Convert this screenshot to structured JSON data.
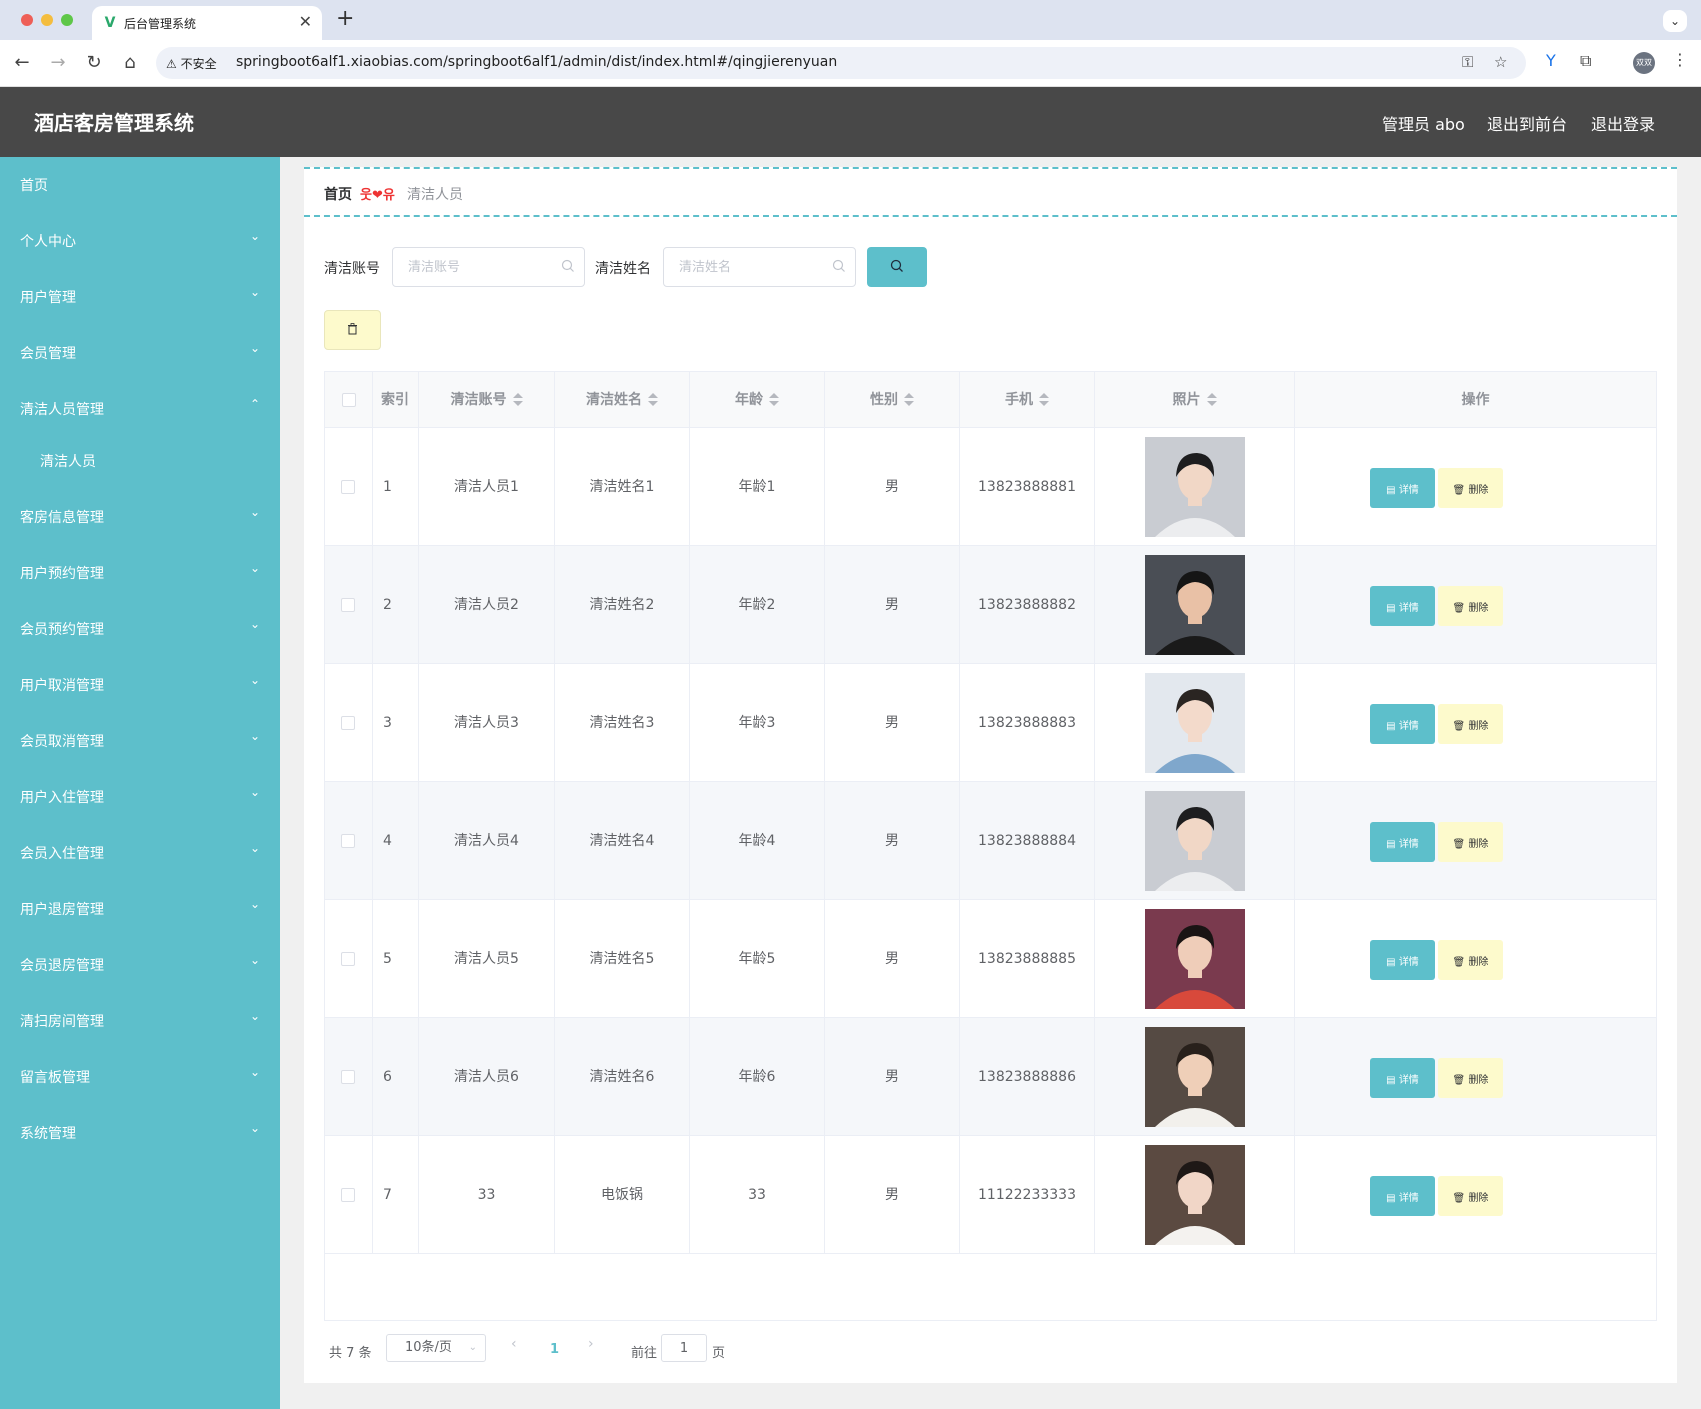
{
  "browser": {
    "tab_title": "后台管理系统",
    "tab_close": "✕",
    "new_tab": "+",
    "security_warning": "不安全",
    "url": "springboot6alf1.xiaobias.com/springboot6alf1/admin/dist/index.html#/qingjierenyuan",
    "profile_initials": "双双"
  },
  "header": {
    "title": "酒店客房管理系统",
    "user": "管理员 abo",
    "to_front": "退出到前台",
    "logout": "退出登录"
  },
  "sidebar": {
    "items": [
      {
        "label": "首页",
        "chevron": ""
      },
      {
        "label": "个人中心",
        "chevron": "⌄"
      },
      {
        "label": "用户管理",
        "chevron": "⌄"
      },
      {
        "label": "会员管理",
        "chevron": "⌄"
      },
      {
        "label": "清洁人员管理",
        "chevron": "⌃"
      },
      {
        "label": "清洁人员",
        "chevron": ""
      },
      {
        "label": "客房信息管理",
        "chevron": "⌄"
      },
      {
        "label": "用户预约管理",
        "chevron": "⌄"
      },
      {
        "label": "会员预约管理",
        "chevron": "⌄"
      },
      {
        "label": "用户取消管理",
        "chevron": "⌄"
      },
      {
        "label": "会员取消管理",
        "chevron": "⌄"
      },
      {
        "label": "用户入住管理",
        "chevron": "⌄"
      },
      {
        "label": "会员入住管理",
        "chevron": "⌄"
      },
      {
        "label": "用户退房管理",
        "chevron": "⌄"
      },
      {
        "label": "会员退房管理",
        "chevron": "⌄"
      },
      {
        "label": "清扫房间管理",
        "chevron": "⌄"
      },
      {
        "label": "留言板管理",
        "chevron": "⌄"
      },
      {
        "label": "系统管理",
        "chevron": "⌄"
      }
    ]
  },
  "breadcrumb": {
    "home": "首页",
    "separator": "웃❤유",
    "current": "清洁人员"
  },
  "search": {
    "account_label": "清洁账号",
    "account_placeholder": "清洁账号",
    "name_label": "清洁姓名",
    "name_placeholder": "清洁姓名"
  },
  "table": {
    "headers": {
      "index": "索引",
      "account": "清洁账号",
      "name": "清洁姓名",
      "age": "年龄",
      "gender": "性别",
      "phone": "手机",
      "photo": "照片",
      "actions": "操作"
    },
    "detail_label": "详情",
    "delete_label": "删除",
    "rows": [
      {
        "index": "1",
        "account": "清洁人员1",
        "name": "清洁姓名1",
        "age": "年龄1",
        "gender": "男",
        "phone": "13823888881",
        "photo": "male-portrait-1"
      },
      {
        "index": "2",
        "account": "清洁人员2",
        "name": "清洁姓名2",
        "age": "年龄2",
        "gender": "男",
        "phone": "13823888882",
        "photo": "male-portrait-2"
      },
      {
        "index": "3",
        "account": "清洁人员3",
        "name": "清洁姓名3",
        "age": "年龄3",
        "gender": "男",
        "phone": "13823888883",
        "photo": "male-portrait-3"
      },
      {
        "index": "4",
        "account": "清洁人员4",
        "name": "清洁姓名4",
        "age": "年龄4",
        "gender": "男",
        "phone": "13823888884",
        "photo": "male-portrait-1"
      },
      {
        "index": "5",
        "account": "清洁人员5",
        "name": "清洁姓名5",
        "age": "年龄5",
        "gender": "男",
        "phone": "13823888885",
        "photo": "female-portrait-1"
      },
      {
        "index": "6",
        "account": "清洁人员6",
        "name": "清洁姓名6",
        "age": "年龄6",
        "gender": "男",
        "phone": "13823888886",
        "photo": "male-portrait-4"
      },
      {
        "index": "7",
        "account": "33",
        "name": "电饭锅",
        "age": "33",
        "gender": "男",
        "phone": "11122233333",
        "photo": "female-portrait-2"
      }
    ]
  },
  "pagination": {
    "total": "共 7 条",
    "page_size": "10条/页",
    "current_page": "1",
    "goto_label": "前往",
    "goto_value": "1",
    "page_word": "页"
  },
  "colors": {
    "accent": "#5dbfcb",
    "header_bg": "#484848",
    "delete_bg": "#fdfacc",
    "breadcrumb_sep": "#ee3333"
  }
}
